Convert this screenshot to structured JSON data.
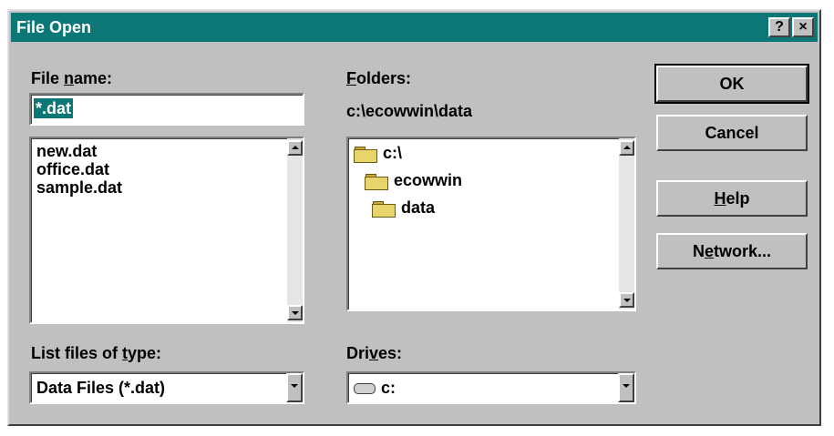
{
  "window": {
    "title": "File Open",
    "help_button": "?",
    "close_button": "×"
  },
  "file_name": {
    "label_prefix": "File ",
    "label_accel": "n",
    "label_suffix": "ame:",
    "value": "*.dat"
  },
  "file_list": {
    "items": [
      "new.dat",
      "office.dat",
      "sample.dat"
    ]
  },
  "folders": {
    "label_accel": "F",
    "label_suffix": "olders:",
    "current_path": "c:\\ecowwin\\data",
    "items": [
      "c:\\",
      "ecowwin",
      "data"
    ]
  },
  "file_type": {
    "label_prefix": "List files of ",
    "label_accel": "t",
    "label_suffix": "ype:",
    "value": "Data Files (*.dat)"
  },
  "drives": {
    "label_prefix": "Dri",
    "label_accel": "v",
    "label_suffix": "es:",
    "value": "c:"
  },
  "buttons": {
    "ok": "OK",
    "cancel": "Cancel",
    "help_accel": "H",
    "help_suffix": "elp",
    "network_prefix": "N",
    "network_accel": "e",
    "network_suffix": "twork..."
  }
}
